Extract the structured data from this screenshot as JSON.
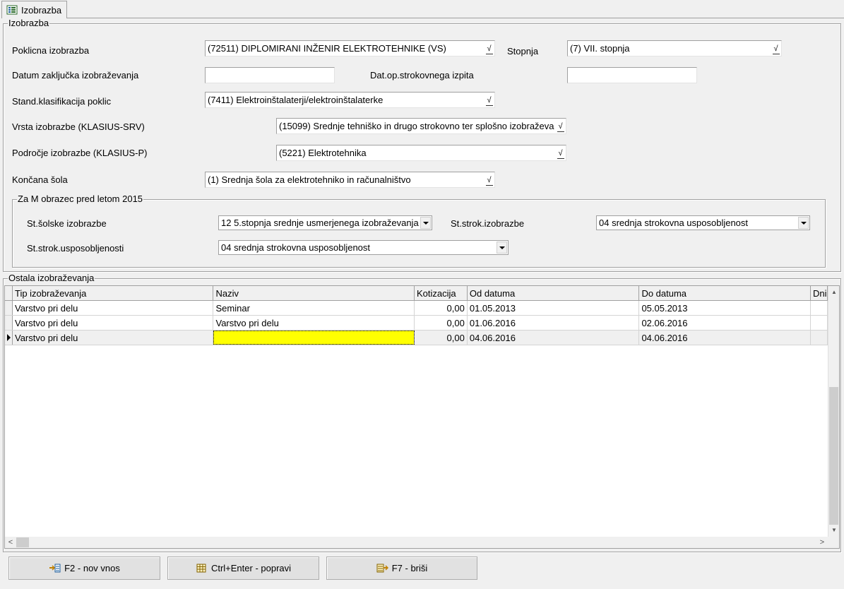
{
  "tab": {
    "label": "Izobrazba",
    "icon": "form-icon"
  },
  "section_izobrazba": {
    "title": "Izobrazba",
    "poklicna_label": "Poklicna izobrazba",
    "poklicna_value": "(72511) DIPLOMIRANI INŽENIR ELEKTROTEHNIKE (VS)",
    "stopnja_label": "Stopnja",
    "stopnja_value": "(7) VII. stopnja",
    "datum_label": "Datum zaključka izobraževanja",
    "datum_value": "",
    "datop_label": "Dat.op.strokovnega izpita",
    "datop_value": "",
    "skp_label": "Stand.klasifikacija poklic",
    "skp_value": "(7411) Elektroinštalaterji/elektroinštalaterke",
    "srv_label": "Vrsta izobrazbe (KLASIUS-SRV)",
    "srv_value": "(15099) Srednje tehniško in drugo strokovno ter splošno izobraževa",
    "p_label": "Področje izobrazbe (KLASIUS-P)",
    "p_value": "(5221) Elektrotehnika",
    "sola_label": "Končana šola",
    "sola_value": "(1) Srednja šola za elektrotehniko in računalništvo",
    "lookup_glyph": "√"
  },
  "section_m": {
    "title": "Za M obrazec pred letom 2015",
    "solske_label": "St.šolske izobrazbe",
    "solske_value": "12 5.stopnja srednje usmerjenega izobraževanja",
    "strok_label": "St.strok.izobrazbe",
    "strok_value": "04 srednja strokovna usposobljenost",
    "usp_label": "St.strok.usposobljenosti",
    "usp_value": "04 srednja strokovna usposobljenost"
  },
  "section_ostala": {
    "title": "Ostala izobraževanja",
    "columns": [
      "Tip izobraževanja",
      "Naziv",
      "Kotizacija",
      "Od datuma",
      "Do datuma",
      "Dni"
    ],
    "rows": [
      {
        "tip": "Varstvo pri delu",
        "naziv": "Seminar",
        "kotizacija": "0,00",
        "od": "01.05.2013",
        "do": "05.05.2013"
      },
      {
        "tip": "Varstvo pri delu",
        "naziv": "Varstvo pri delu",
        "kotizacija": "0,00",
        "od": "01.06.2016",
        "do": "02.06.2016"
      },
      {
        "tip": "Varstvo pri delu",
        "naziv": "",
        "kotizacija": "0,00",
        "od": "04.06.2016",
        "do": "04.06.2016"
      }
    ]
  },
  "scroll": {
    "up": "▲",
    "down": "▼",
    "left": "<",
    "right": ">"
  },
  "buttons": {
    "new": "F2 - nov vnos",
    "edit": "Ctrl+Enter - popravi",
    "delete": "F7 - briši"
  }
}
